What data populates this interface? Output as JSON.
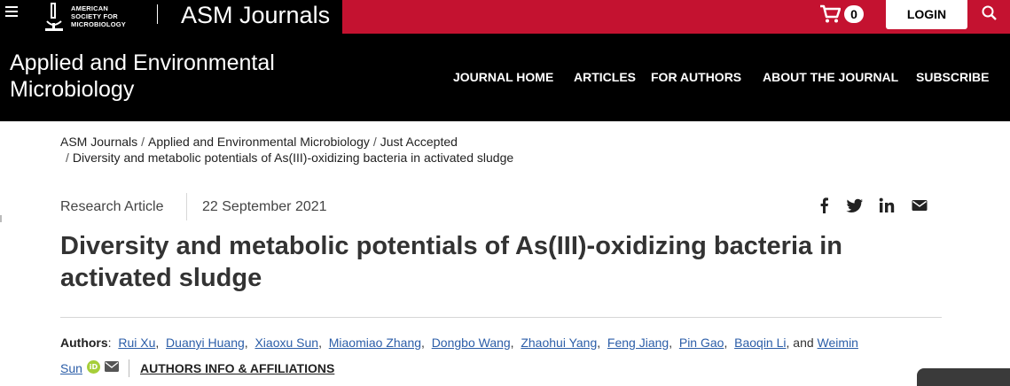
{
  "topbar": {
    "logo_text": [
      "AMERICAN",
      "SOCIETY FOR",
      "MICROBIOLOGY"
    ],
    "site_name": "ASM Journals",
    "cart_count": "0",
    "login_label": "LOGIN",
    "colors": {
      "black": "#000000",
      "red": "#c41230"
    }
  },
  "journal": {
    "title_line1": "Applied and Environmental",
    "title_line2": "Microbiology",
    "nav": [
      "JOURNAL HOME",
      "ARTICLES",
      "FOR AUTHORS",
      "ABOUT THE JOURNAL",
      "SUBSCRIBE"
    ]
  },
  "breadcrumb": {
    "items": [
      "ASM Journals",
      "Applied and Environmental Microbiology",
      "Just Accepted",
      "Diversity and metabolic potentials of As(III)-oxidizing bacteria in activated sludge"
    ],
    "separator": "/"
  },
  "article": {
    "type": "Research Article",
    "date": "22 September 2021",
    "title": "Diversity and metabolic potentials of As(III)-oxidizing bacteria in activated sludge",
    "share_icons": [
      "facebook-icon",
      "twitter-icon",
      "linkedin-icon",
      "email-icon"
    ]
  },
  "authors": {
    "label": "Authors",
    "colon": ":",
    "names": [
      "Rui Xu",
      "Duanyi Huang",
      "Xiaoxu Sun",
      "Miaomiao Zhang",
      "Dongbo Wang",
      "Zhaohui Yang",
      "Feng Jiang",
      "Pin Gao",
      "Baoqin Li"
    ],
    "and": ", and",
    "last_first": "Weimin",
    "last_second": "Sun",
    "orcid_label": "iD",
    "affiliations_link": "AUTHORS INFO & AFFILIATIONS",
    "link_color": "#2c5ea8"
  }
}
